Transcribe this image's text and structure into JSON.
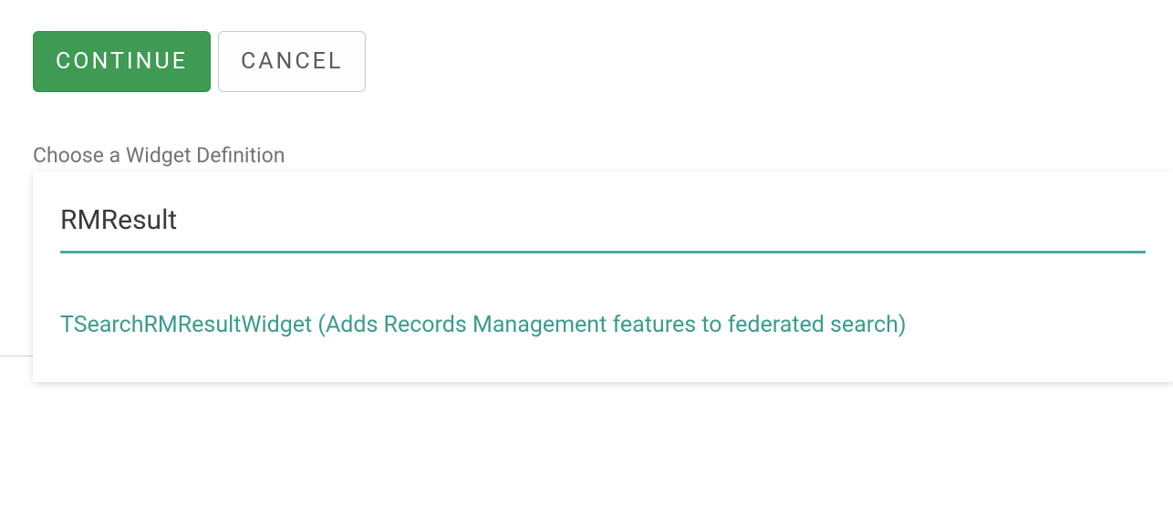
{
  "toolbar": {
    "continue_label": "Continue",
    "cancel_label": "Cancel"
  },
  "section": {
    "label": "Choose a Widget Definition"
  },
  "search": {
    "value": "RMResult"
  },
  "results": [
    {
      "label": "TSearchRMResultWidget (Adds Records Management features to federated search)"
    }
  ]
}
